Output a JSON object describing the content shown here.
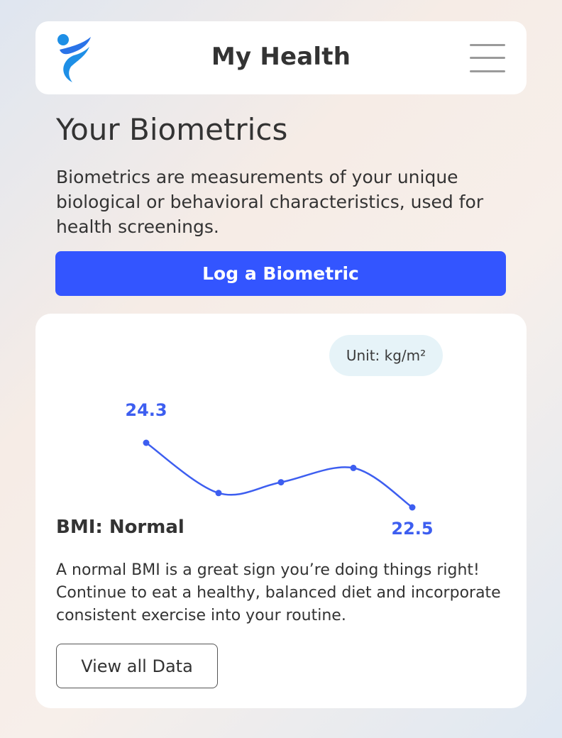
{
  "header": {
    "title": "My Health",
    "logo_icon": "figure-logo-icon",
    "menu_icon": "hamburger-menu-icon"
  },
  "page": {
    "heading": "Your Biometrics",
    "intro": "Biometrics are measurements of your unique biological or behavioral characteristics, used for health screenings.",
    "log_button": "Log a Biometric"
  },
  "card": {
    "unit": "Unit: kg/m²",
    "status": "BMI: Normal",
    "description": "A normal BMI is a great sign you’re doing things right! Continue to eat a healthy, balanced diet and incorporate consistent exercise into your routine.",
    "view_button": "View all Data"
  },
  "colors": {
    "accent": "#3355ff",
    "line": "#3d5ef0",
    "unit_pill": "#e6f3f8"
  },
  "chart_data": {
    "type": "line",
    "x": [
      1,
      2,
      3,
      4,
      5
    ],
    "values": [
      24.3,
      22.9,
      23.2,
      23.6,
      22.5
    ],
    "data_labels": [
      {
        "point": 0,
        "text": "24.3"
      },
      {
        "point": 4,
        "text": "22.5"
      }
    ],
    "ylim": [
      22.5,
      24.3
    ],
    "grid": false
  }
}
